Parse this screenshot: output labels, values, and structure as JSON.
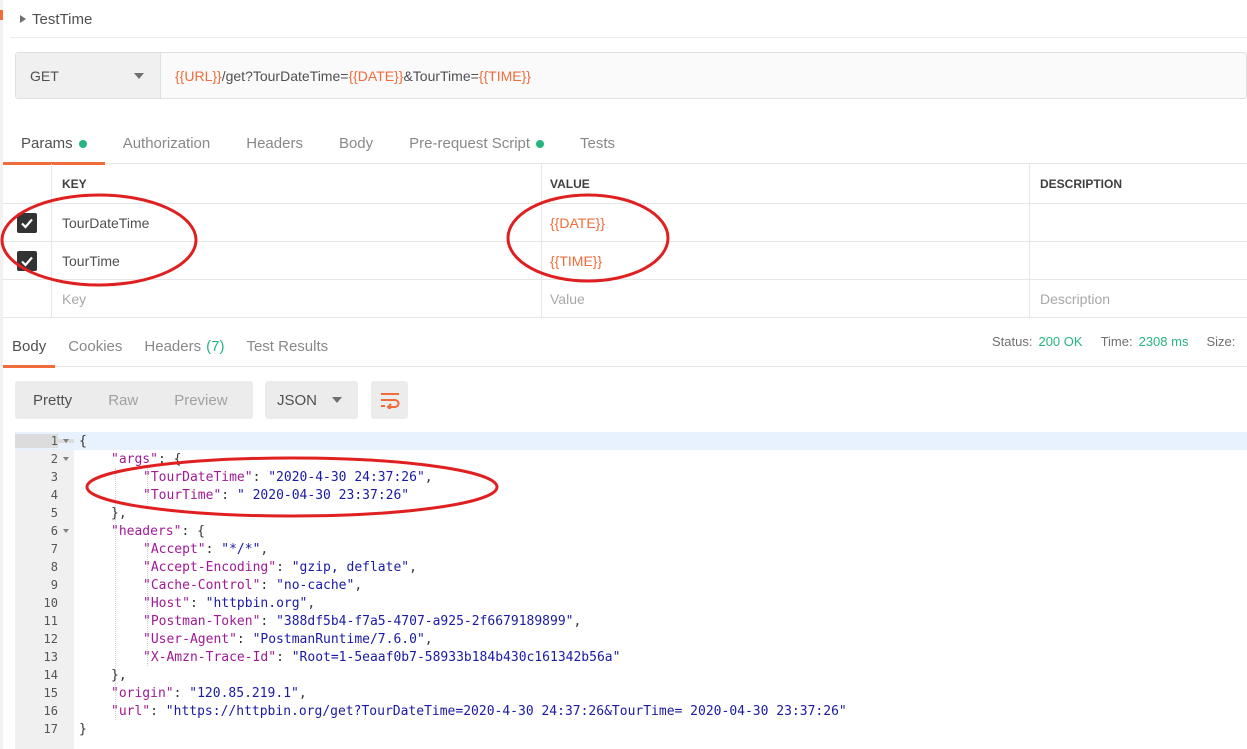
{
  "request": {
    "name": "TestTime",
    "method": "GET",
    "url_parts": [
      {
        "text": "{{URL}}",
        "var": true
      },
      {
        "text": "/get?TourDateTime=",
        "var": false
      },
      {
        "text": "{{DATE}}",
        "var": true
      },
      {
        "text": "&TourTime=",
        "var": false
      },
      {
        "text": "{{TIME}}",
        "var": true
      }
    ]
  },
  "request_tabs": [
    {
      "label": "Params",
      "active": true,
      "dot": true
    },
    {
      "label": "Authorization",
      "active": false,
      "dot": false
    },
    {
      "label": "Headers",
      "active": false,
      "dot": false
    },
    {
      "label": "Body",
      "active": false,
      "dot": false
    },
    {
      "label": "Pre-request Script",
      "active": false,
      "dot": true
    },
    {
      "label": "Tests",
      "active": false,
      "dot": false
    }
  ],
  "params": {
    "headers": {
      "key": "KEY",
      "value": "VALUE",
      "description": "DESCRIPTION"
    },
    "rows": [
      {
        "key": "TourDateTime",
        "value": "{{DATE}}",
        "description": "",
        "checked": true
      },
      {
        "key": "TourTime",
        "value": "{{TIME}}",
        "description": "",
        "checked": true
      }
    ],
    "placeholder": {
      "key": "Key",
      "value": "Value",
      "description": "Description"
    }
  },
  "response_tabs": {
    "body": "Body",
    "cookies": "Cookies",
    "headers": "Headers",
    "headers_count": "(7)",
    "test_results": "Test Results"
  },
  "status": {
    "status_label": "Status:",
    "status_value": "200 OK",
    "time_label": "Time:",
    "time_value": "2308 ms",
    "size_label": "Size:"
  },
  "view": {
    "pretty": "Pretty",
    "raw": "Raw",
    "preview": "Preview",
    "format": "JSON"
  },
  "code_lines": [
    {
      "n": "1",
      "fold": true,
      "indent": 0,
      "parts": [
        [
          "p",
          "{"
        ]
      ]
    },
    {
      "n": "2",
      "fold": true,
      "indent": 1,
      "parts": [
        [
          "k",
          "\"args\""
        ],
        [
          "p",
          ": {"
        ]
      ]
    },
    {
      "n": "3",
      "fold": false,
      "indent": 2,
      "parts": [
        [
          "k",
          "\"TourDateTime\""
        ],
        [
          "p",
          ": "
        ],
        [
          "s",
          "\"2020-4-30 24:37:26\""
        ],
        [
          "p",
          ","
        ]
      ]
    },
    {
      "n": "4",
      "fold": false,
      "indent": 2,
      "parts": [
        [
          "k",
          "\"TourTime\""
        ],
        [
          "p",
          ": "
        ],
        [
          "s",
          "\" 2020-04-30 23:37:26\""
        ]
      ]
    },
    {
      "n": "5",
      "fold": false,
      "indent": 1,
      "parts": [
        [
          "p",
          "},"
        ]
      ]
    },
    {
      "n": "6",
      "fold": true,
      "indent": 1,
      "parts": [
        [
          "k",
          "\"headers\""
        ],
        [
          "p",
          ": {"
        ]
      ]
    },
    {
      "n": "7",
      "fold": false,
      "indent": 2,
      "parts": [
        [
          "k",
          "\"Accept\""
        ],
        [
          "p",
          ": "
        ],
        [
          "s",
          "\"*/*\""
        ],
        [
          "p",
          ","
        ]
      ]
    },
    {
      "n": "8",
      "fold": false,
      "indent": 2,
      "parts": [
        [
          "k",
          "\"Accept-Encoding\""
        ],
        [
          "p",
          ": "
        ],
        [
          "s",
          "\"gzip, deflate\""
        ],
        [
          "p",
          ","
        ]
      ]
    },
    {
      "n": "9",
      "fold": false,
      "indent": 2,
      "parts": [
        [
          "k",
          "\"Cache-Control\""
        ],
        [
          "p",
          ": "
        ],
        [
          "s",
          "\"no-cache\""
        ],
        [
          "p",
          ","
        ]
      ]
    },
    {
      "n": "10",
      "fold": false,
      "indent": 2,
      "parts": [
        [
          "k",
          "\"Host\""
        ],
        [
          "p",
          ": "
        ],
        [
          "s",
          "\"httpbin.org\""
        ],
        [
          "p",
          ","
        ]
      ]
    },
    {
      "n": "11",
      "fold": false,
      "indent": 2,
      "parts": [
        [
          "k",
          "\"Postman-Token\""
        ],
        [
          "p",
          ": "
        ],
        [
          "s",
          "\"388df5b4-f7a5-4707-a925-2f6679189899\""
        ],
        [
          "p",
          ","
        ]
      ]
    },
    {
      "n": "12",
      "fold": false,
      "indent": 2,
      "parts": [
        [
          "k",
          "\"User-Agent\""
        ],
        [
          "p",
          ": "
        ],
        [
          "s",
          "\"PostmanRuntime/7.6.0\""
        ],
        [
          "p",
          ","
        ]
      ]
    },
    {
      "n": "13",
      "fold": false,
      "indent": 2,
      "parts": [
        [
          "k",
          "\"X-Amzn-Trace-Id\""
        ],
        [
          "p",
          ": "
        ],
        [
          "s",
          "\"Root=1-5eaaf0b7-58933b184b430c161342b56a\""
        ]
      ]
    },
    {
      "n": "14",
      "fold": false,
      "indent": 1,
      "parts": [
        [
          "p",
          "},"
        ]
      ]
    },
    {
      "n": "15",
      "fold": false,
      "indent": 1,
      "parts": [
        [
          "k",
          "\"origin\""
        ],
        [
          "p",
          ": "
        ],
        [
          "s",
          "\"120.85.219.1\""
        ],
        [
          "p",
          ","
        ]
      ]
    },
    {
      "n": "16",
      "fold": false,
      "indent": 1,
      "parts": [
        [
          "k",
          "\"url\""
        ],
        [
          "p",
          ": "
        ],
        [
          "s",
          "\"https://httpbin.org/get?TourDateTime=2020-4-30 24:37:26&TourTime= 2020-04-30 23:37:26\""
        ]
      ]
    },
    {
      "n": "17",
      "fold": false,
      "indent": 0,
      "parts": [
        [
          "p",
          "}"
        ]
      ]
    }
  ],
  "colors": {
    "accent": "#f26b3a",
    "success": "#26b47f",
    "annotation": "#e02020"
  }
}
